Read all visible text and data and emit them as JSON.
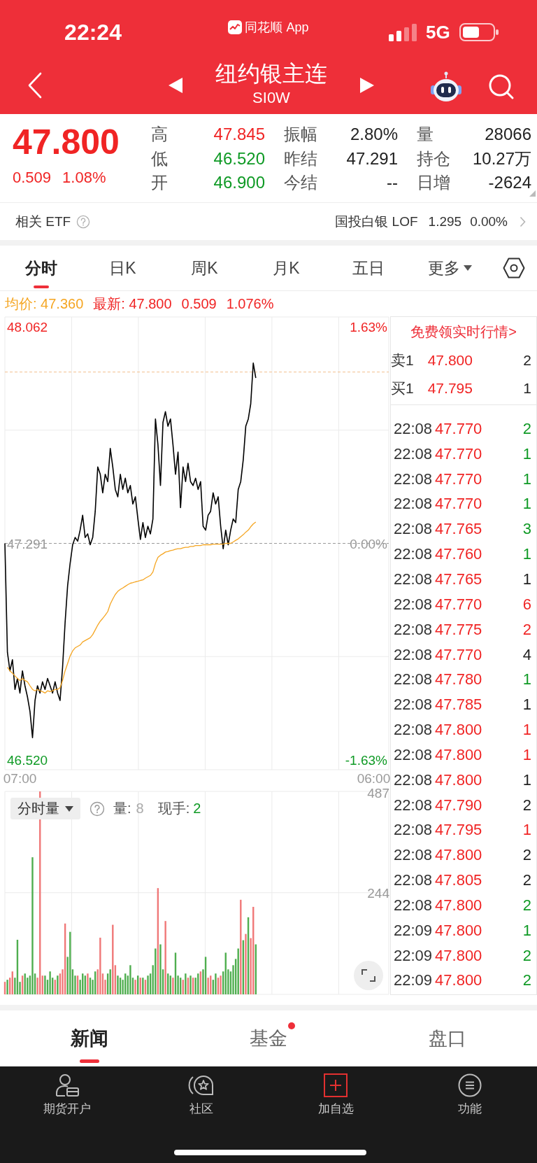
{
  "status_bar": {
    "time": "22:24",
    "app": "同花顺 App",
    "network": "5G"
  },
  "header": {
    "title": "纽约银主连",
    "code": "SI0W"
  },
  "quote": {
    "price": "47.800",
    "change": "0.509",
    "change_pct": "1.08%",
    "stats": [
      {
        "label": "高",
        "value": "47.845",
        "color": "#f02424"
      },
      {
        "label": "振幅",
        "value": "2.80%",
        "color": "#222222"
      },
      {
        "label": "量",
        "value": "28066",
        "color": "#222222"
      },
      {
        "label": "低",
        "value": "46.520",
        "color": "#0f9a25"
      },
      {
        "label": "昨结",
        "value": "47.291",
        "color": "#222222"
      },
      {
        "label": "持仓",
        "value": "10.27万",
        "color": "#222222"
      },
      {
        "label": "开",
        "value": "46.900",
        "color": "#0f9a25"
      },
      {
        "label": "今结",
        "value": "--",
        "color": "#222222"
      },
      {
        "label": "日增",
        "value": "-2624",
        "color": "#222222"
      }
    ]
  },
  "etf": {
    "label": "相关 ETF",
    "name": "国投白银 LOF",
    "price": "1.295",
    "change": "0.00%"
  },
  "chart_tabs": [
    {
      "label": "分时",
      "selected": true,
      "kind": "tab"
    },
    {
      "label": "日K",
      "selected": false,
      "kind": "tab"
    },
    {
      "label": "周K",
      "selected": false,
      "kind": "tab"
    },
    {
      "label": "月K",
      "selected": false,
      "kind": "tab"
    },
    {
      "label": "五日",
      "selected": false,
      "kind": "tab"
    },
    {
      "label": "更多",
      "selected": false,
      "kind": "menu"
    }
  ],
  "price_info": {
    "avg": "均价: 47.360",
    "latest": "最新: 47.800",
    "change": "0.509",
    "change_pct": "1.076%"
  },
  "price_chart": {
    "percent_labels": [
      "1.63%",
      "0.00%",
      "-1.63%"
    ],
    "chart_data": {
      "type": "line",
      "categories": [
        null,
        null,
        null,
        null,
        null,
        null,
        "07:00",
        null,
        null,
        null,
        null,
        null,
        null,
        null,
        null,
        null,
        null,
        null,
        null,
        null,
        null,
        null,
        null,
        null,
        null,
        null,
        null,
        null,
        null,
        null,
        null,
        null,
        null,
        null,
        null,
        null,
        null,
        null,
        null,
        null,
        null,
        null,
        null,
        null,
        null,
        null,
        null,
        null,
        null,
        null,
        null,
        null,
        null,
        null,
        null,
        null,
        null,
        null,
        null,
        null,
        null,
        null,
        null,
        null,
        null,
        null,
        null,
        null,
        null,
        null,
        null,
        null,
        null,
        null,
        null,
        null,
        null,
        null,
        null,
        null,
        null,
        null,
        null,
        null,
        null,
        null,
        null,
        null,
        null,
        null,
        null,
        null,
        null,
        null,
        null,
        null,
        null,
        null,
        null,
        null,
        null,
        null,
        null,
        null,
        null,
        null,
        null,
        null,
        null,
        null,
        null,
        null,
        null,
        null,
        null,
        null,
        null,
        null,
        null,
        null,
        null,
        null,
        null,
        null,
        null,
        null,
        null,
        null,
        null,
        null,
        null,
        null,
        null,
        null,
        null,
        null,
        null,
        null,
        null,
        null,
        null,
        null,
        null,
        null,
        null,
        null,
        null,
        "06:00",
        null,
        null,
        null,
        null,
        null,
        null
      ],
      "series": [
        {
          "color": "#000000",
          "values": [
            47.291,
            46.903,
            46.837,
            46.877,
            46.771,
            46.81,
            46.758,
            46.837,
            46.784,
            46.744,
            46.692,
            46.599,
            46.732,
            46.784,
            46.758,
            46.798,
            46.771,
            46.81,
            46.784,
            46.758,
            46.798,
            46.758,
            46.732,
            46.85,
            47.009,
            47.14,
            47.22,
            47.286,
            47.312,
            47.299,
            47.338,
            47.391,
            47.312,
            47.325,
            47.286,
            47.312,
            47.405,
            47.563,
            47.537,
            47.471,
            47.537,
            47.511,
            47.629,
            47.563,
            47.483,
            47.457,
            47.537,
            47.483,
            47.523,
            47.471,
            47.497,
            47.431,
            47.457,
            47.378,
            47.305,
            47.365,
            47.312,
            47.352,
            47.325,
            47.378,
            47.734,
            47.642,
            47.497,
            47.722,
            47.76,
            47.708,
            47.734,
            47.642,
            47.537,
            47.616,
            47.418,
            47.563,
            47.511,
            47.576,
            47.511,
            47.497,
            47.523,
            47.483,
            47.511,
            47.352,
            47.338,
            47.391,
            47.405,
            47.471,
            47.431,
            47.457,
            47.352,
            47.272,
            47.338,
            47.286,
            47.338,
            47.378,
            47.365,
            47.483,
            47.511,
            47.589,
            47.708,
            47.734,
            47.788,
            47.933,
            47.88,
            null,
            null,
            null,
            null,
            null,
            null,
            null,
            null,
            null,
            null,
            null,
            null,
            null,
            null,
            null,
            null,
            null,
            null,
            null,
            null,
            null,
            null,
            null,
            null,
            null,
            null,
            null,
            null,
            null,
            null,
            null,
            null,
            null,
            null,
            null,
            null,
            null,
            null,
            null,
            null,
            null,
            null,
            null,
            null,
            null,
            null,
            null,
            null,
            null,
            null,
            null,
            null,
            null
          ]
        },
        {
          "color": "#f5a623",
          "values": [
            null,
            46.85,
            46.837,
            46.829,
            46.819,
            46.81,
            46.803,
            46.81,
            46.803,
            46.798,
            46.784,
            46.771,
            46.766,
            46.771,
            46.766,
            46.763,
            46.758,
            46.766,
            46.763,
            46.766,
            46.771,
            46.771,
            46.777,
            46.803,
            46.837,
            46.863,
            46.89,
            46.908,
            46.919,
            46.924,
            46.929,
            46.94,
            46.945,
            46.95,
            46.955,
            46.966,
            46.983,
            47.0,
            47.014,
            47.024,
            47.035,
            47.048,
            47.075,
            47.093,
            47.109,
            47.12,
            47.127,
            47.132,
            47.138,
            47.144,
            47.149,
            47.151,
            47.154,
            47.156,
            47.159,
            47.161,
            47.167,
            47.172,
            47.177,
            47.189,
            47.22,
            47.241,
            47.249,
            47.254,
            47.26,
            47.262,
            47.265,
            47.267,
            47.27,
            47.272,
            47.272,
            47.275,
            47.277,
            47.277,
            47.28,
            47.28,
            47.283,
            47.283,
            47.283,
            47.286,
            47.286,
            47.286,
            47.286,
            47.288,
            47.288,
            47.288,
            47.288,
            47.288,
            47.291,
            47.291,
            47.291,
            47.296,
            47.302,
            47.307,
            47.315,
            47.322,
            47.331,
            47.338,
            47.35,
            47.36,
            47.367,
            null,
            null,
            null,
            null,
            null,
            null,
            null,
            null,
            null,
            null,
            null,
            null,
            null,
            null,
            null,
            null,
            null,
            null,
            null,
            null,
            null,
            null,
            null,
            null,
            null,
            null,
            null,
            null,
            null,
            null,
            null,
            null,
            null,
            null,
            null,
            null,
            null,
            null,
            null,
            null,
            null,
            null,
            null,
            null,
            null,
            null,
            null,
            null,
            null,
            null,
            null,
            null,
            null
          ]
        }
      ],
      "ylim": [
        46.485,
        48.097
      ],
      "yticks": [
        {
          "value": 46.52,
          "label": "46.520"
        },
        {
          "value": 47.291,
          "label": "47.291"
        },
        {
          "value": 48.062,
          "label": "48.062"
        }
      ],
      "ref_lines": [
        {
          "axis": "y",
          "value": 47.291,
          "color": "#9a9a9a"
        },
        {
          "axis": "y",
          "value": 47.901,
          "color": "#f2c08e"
        }
      ]
    }
  },
  "volume_chart": {
    "selector": "分时量",
    "volume_label": "量:",
    "volume": "8",
    "hand_label": "现手:",
    "hand": "2",
    "chart_data": {
      "type": "bar",
      "categories": [
        null,
        null,
        null,
        null,
        null,
        null,
        null,
        null,
        null,
        null,
        null,
        null,
        null,
        null,
        null,
        null,
        null,
        null,
        null,
        null,
        null,
        null,
        null,
        null,
        null,
        null,
        null,
        null,
        null,
        null,
        null,
        null,
        null,
        null,
        null,
        null,
        null,
        null,
        null,
        null,
        null,
        null,
        null,
        null,
        null,
        null,
        null,
        null,
        null,
        null,
        null,
        null,
        null,
        null,
        null,
        null,
        null,
        null,
        null,
        null,
        null,
        null,
        null,
        null,
        null,
        null,
        null,
        null,
        null,
        null,
        null,
        null,
        null,
        null,
        null,
        null,
        null,
        null,
        null,
        null,
        null,
        null,
        null,
        null,
        null,
        null,
        null,
        null,
        null,
        null,
        null,
        null,
        null,
        null,
        null,
        null,
        null,
        null,
        null,
        null,
        null,
        null,
        null,
        null,
        null,
        null,
        null,
        null,
        null,
        null,
        null,
        null,
        null,
        null,
        null,
        null,
        null,
        null,
        null,
        null,
        null,
        null,
        null,
        null,
        null,
        null,
        null,
        null,
        null,
        null,
        null,
        null,
        null,
        null,
        null,
        null,
        null,
        null,
        null,
        null,
        null,
        null,
        null,
        null,
        null,
        null,
        null,
        null,
        null,
        null,
        null,
        null,
        null,
        null
      ],
      "series": [
        {
          "color": "#f07878",
          "values": [
            30,
            null,
            40,
            55,
            null,
            null,
            null,
            45,
            null,
            null,
            null,
            null,
            null,
            40,
            487,
            45,
            null,
            null,
            null,
            null,
            35,
            null,
            50,
            60,
            170,
            null,
            null,
            null,
            null,
            45,
            null,
            null,
            null,
            50,
            null,
            null,
            null,
            60,
            136,
            50,
            35,
            null,
            null,
            167,
            70,
            null,
            null,
            null,
            null,
            null,
            null,
            null,
            35,
            null,
            40,
            null,
            35,
            null,
            null,
            null,
            null,
            255,
            null,
            null,
            176,
            null,
            null,
            40,
            null,
            null,
            null,
            35,
            null,
            40,
            null,
            40,
            null,
            null,
            55,
            null,
            null,
            40,
            45,
            null,
            null,
            40,
            45,
            null,
            null,
            null,
            null,
            null,
            null,
            null,
            227,
            null,
            145,
            null,
            135,
            210,
            null,
            null,
            null,
            null,
            null,
            null,
            null,
            null,
            null,
            null,
            null,
            null,
            null,
            null,
            null,
            null,
            null,
            null,
            null,
            null,
            null,
            null,
            null,
            null,
            null,
            null,
            null,
            null,
            null,
            null,
            null,
            null,
            null,
            null,
            null,
            null,
            null,
            null,
            null,
            null,
            null,
            null,
            null,
            null,
            null,
            null,
            null,
            null,
            null,
            null,
            null,
            null,
            null,
            null
          ]
        },
        {
          "color": "#4fae4f",
          "values": [
            null,
            35,
            null,
            null,
            40,
            131,
            30,
            null,
            50,
            40,
            45,
            329,
            50,
            null,
            null,
            null,
            45,
            35,
            55,
            40,
            null,
            45,
            null,
            null,
            null,
            90,
            150,
            60,
            45,
            null,
            35,
            50,
            45,
            null,
            40,
            35,
            55,
            null,
            null,
            null,
            null,
            50,
            60,
            null,
            null,
            45,
            40,
            35,
            50,
            45,
            70,
            40,
            null,
            45,
            null,
            40,
            null,
            45,
            50,
            70,
            110,
            null,
            120,
            60,
            null,
            50,
            45,
            null,
            100,
            45,
            40,
            null,
            50,
            null,
            45,
            null,
            40,
            50,
            null,
            60,
            90,
            null,
            null,
            35,
            50,
            null,
            null,
            55,
            100,
            60,
            55,
            70,
            85,
            110,
            null,
            130,
            null,
            185,
            null,
            null,
            120,
            null,
            null,
            null,
            null,
            null,
            null,
            null,
            null,
            null,
            null,
            null,
            null,
            null,
            null,
            null,
            null,
            null,
            null,
            null,
            null,
            null,
            null,
            null,
            null,
            null,
            null,
            null,
            null,
            null,
            null,
            null,
            null,
            null,
            null,
            null,
            null,
            null,
            null,
            null,
            null,
            null,
            null,
            null,
            null,
            null,
            null,
            null,
            null,
            null,
            null,
            null,
            null,
            null
          ]
        }
      ],
      "ylim": [
        0,
        487
      ],
      "yticks": [
        {
          "value": 244,
          "label": "244"
        },
        {
          "value": 487,
          "label": "487"
        }
      ]
    }
  },
  "order_book": {
    "promo": "免费领实时行情>",
    "levels": [
      {
        "label": "卖1",
        "price": "47.800",
        "volume": "2"
      },
      {
        "label": "买1",
        "price": "47.795",
        "volume": "1"
      }
    ]
  },
  "trades": [
    {
      "time": "22:08",
      "price": "47.770",
      "volume": "2",
      "color": "#0f9a25"
    },
    {
      "time": "22:08",
      "price": "47.770",
      "volume": "1",
      "color": "#0f9a25"
    },
    {
      "time": "22:08",
      "price": "47.770",
      "volume": "1",
      "color": "#0f9a25"
    },
    {
      "time": "22:08",
      "price": "47.770",
      "volume": "1",
      "color": "#0f9a25"
    },
    {
      "time": "22:08",
      "price": "47.765",
      "volume": "3",
      "color": "#0f9a25"
    },
    {
      "time": "22:08",
      "price": "47.760",
      "volume": "1",
      "color": "#0f9a25"
    },
    {
      "time": "22:08",
      "price": "47.765",
      "volume": "1",
      "color": "#222222"
    },
    {
      "time": "22:08",
      "price": "47.770",
      "volume": "6",
      "color": "#f02424"
    },
    {
      "time": "22:08",
      "price": "47.775",
      "volume": "2",
      "color": "#f02424"
    },
    {
      "time": "22:08",
      "price": "47.770",
      "volume": "4",
      "color": "#222222"
    },
    {
      "time": "22:08",
      "price": "47.780",
      "volume": "1",
      "color": "#0f9a25"
    },
    {
      "time": "22:08",
      "price": "47.785",
      "volume": "1",
      "color": "#222222"
    },
    {
      "time": "22:08",
      "price": "47.800",
      "volume": "1",
      "color": "#f02424"
    },
    {
      "time": "22:08",
      "price": "47.800",
      "volume": "1",
      "color": "#f02424"
    },
    {
      "time": "22:08",
      "price": "47.800",
      "volume": "1",
      "color": "#222222"
    },
    {
      "time": "22:08",
      "price": "47.790",
      "volume": "2",
      "color": "#222222"
    },
    {
      "time": "22:08",
      "price": "47.795",
      "volume": "1",
      "color": "#f02424"
    },
    {
      "time": "22:08",
      "price": "47.800",
      "volume": "2",
      "color": "#222222"
    },
    {
      "time": "22:08",
      "price": "47.805",
      "volume": "2",
      "color": "#222222"
    },
    {
      "time": "22:08",
      "price": "47.800",
      "volume": "2",
      "color": "#0f9a25"
    },
    {
      "time": "22:09",
      "price": "47.800",
      "volume": "1",
      "color": "#0f9a25"
    },
    {
      "time": "22:09",
      "price": "47.800",
      "volume": "2",
      "color": "#0f9a25"
    },
    {
      "time": "22:09",
      "price": "47.800",
      "volume": "2",
      "color": "#0f9a25"
    }
  ],
  "bottom_tabs": [
    {
      "label": "新闻",
      "selected": true,
      "badge": false
    },
    {
      "label": "基金",
      "selected": false,
      "badge": true
    },
    {
      "label": "盘口",
      "selected": false,
      "badge": false
    }
  ],
  "bottom_nav": [
    {
      "label": "期货开户",
      "kind": "account"
    },
    {
      "label": "社区",
      "kind": "community"
    },
    {
      "label": "加自选",
      "kind": "watchlist"
    },
    {
      "label": "功能",
      "kind": "menu"
    }
  ]
}
